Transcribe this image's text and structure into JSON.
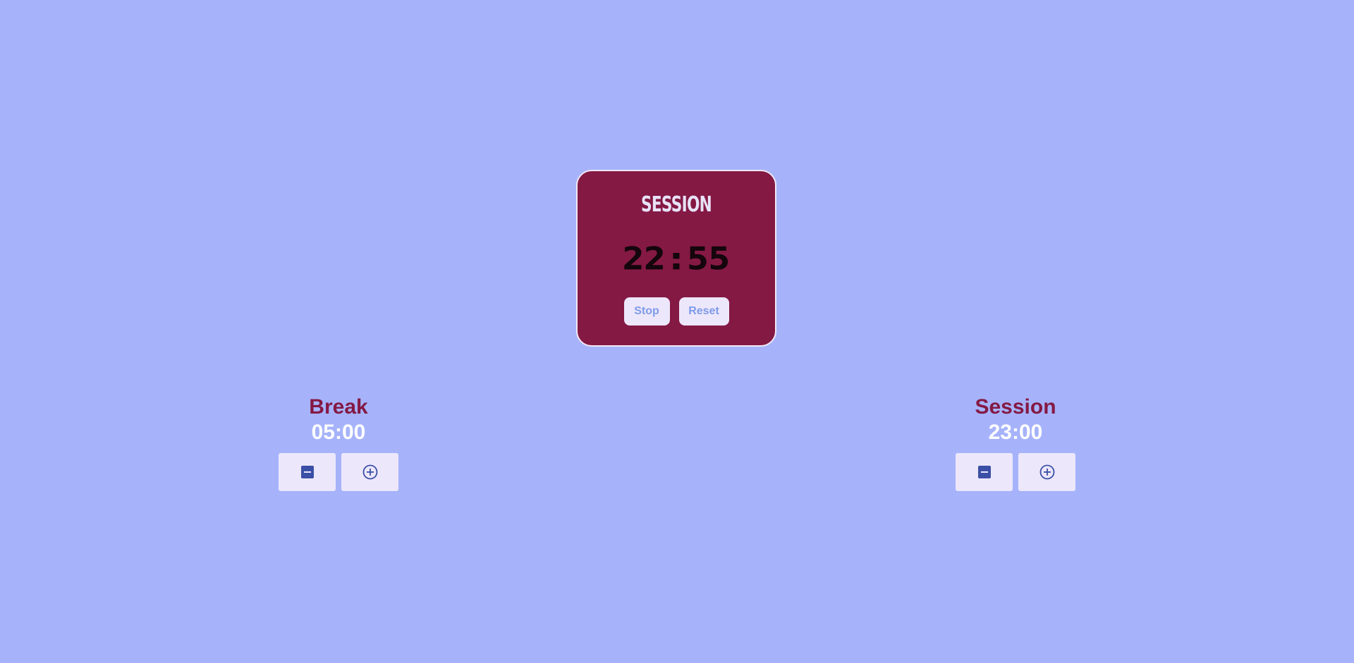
{
  "timer": {
    "label": "SESSION",
    "time": "22:55",
    "stop_label": "Stop",
    "reset_label": "Reset"
  },
  "break": {
    "title": "Break",
    "value": "05:00",
    "decrement_icon": "minus-square-icon",
    "increment_icon": "plus-circle-icon"
  },
  "session": {
    "title": "Session",
    "value": "23:00",
    "decrement_icon": "minus-square-icon",
    "increment_icon": "plus-circle-icon"
  },
  "colors": {
    "background": "#a6b3fb",
    "card": "#841944",
    "accent_text": "#841944",
    "button_bg": "#ece7fb",
    "button_text": "#7e9bea",
    "icon": "#3b4fa6"
  }
}
